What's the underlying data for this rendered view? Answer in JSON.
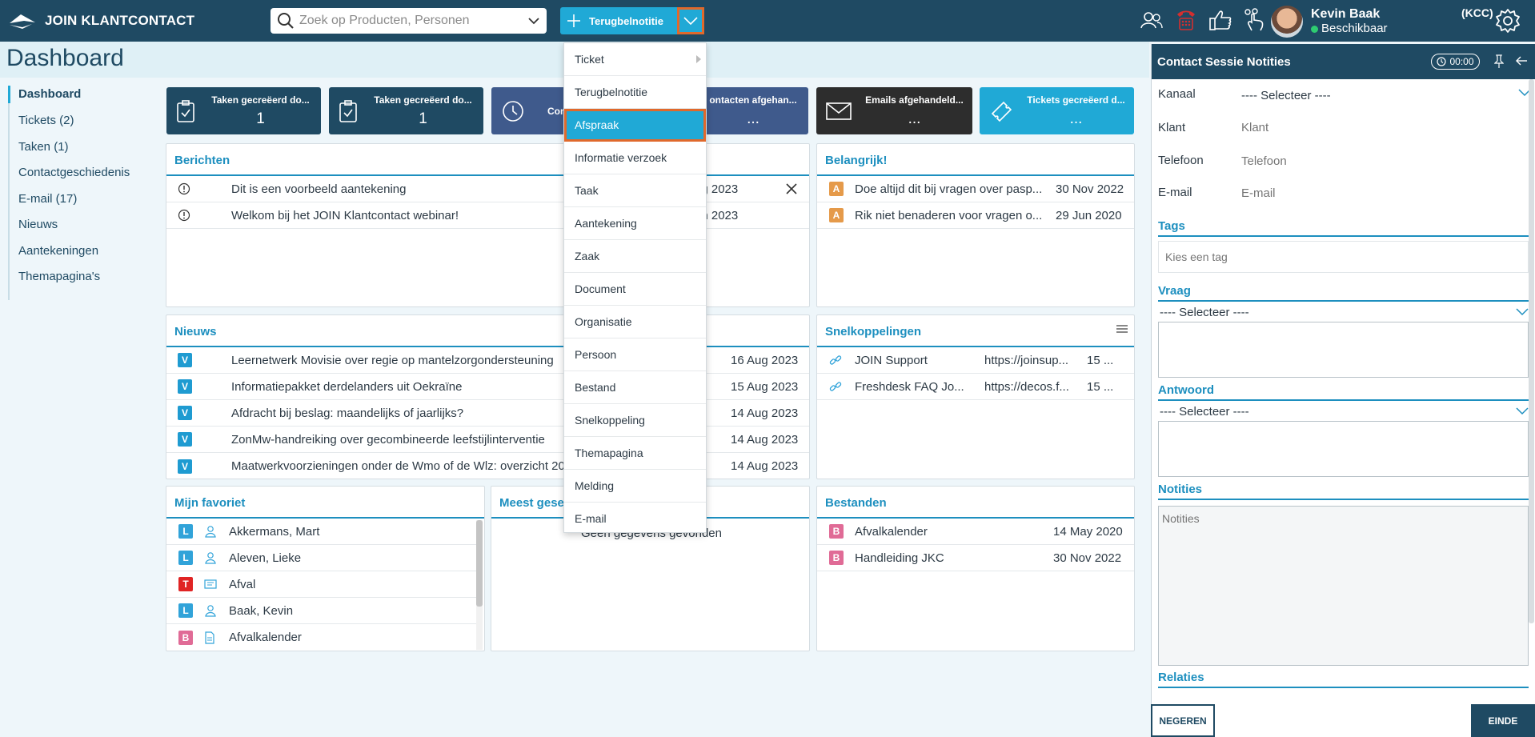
{
  "app": {
    "title": "JOIN KLANTCONTACT"
  },
  "search": {
    "placeholder": "Zoek op Producten, Personen"
  },
  "new_button": {
    "label": "Terugbelnotitie"
  },
  "user": {
    "name": "Kevin Baak",
    "status": "Beschikbaar",
    "role": "(KCC)"
  },
  "page": {
    "title": "Dashboard"
  },
  "sidebar": {
    "items": [
      {
        "label": "Dashboard"
      },
      {
        "label": "Tickets (2)"
      },
      {
        "label": "Taken (1)"
      },
      {
        "label": "Contactgeschiedenis"
      },
      {
        "label": "E-mail (17)"
      },
      {
        "label": "Nieuws"
      },
      {
        "label": "Aantekeningen"
      },
      {
        "label": "Themapagina's"
      }
    ]
  },
  "kpis": [
    {
      "label": "Taken gecreëerd do...",
      "value": "1",
      "color": "#1f4a63"
    },
    {
      "label": "Taken gecreëerd do...",
      "value": "1",
      "color": "#1f4a63"
    },
    {
      "label": "Conta",
      "value": "",
      "color": "#3f5a8c"
    },
    {
      "label": "ontacten afgehan...",
      "value": "...",
      "color": "#3f5a8c"
    },
    {
      "label": "Emails afgehandeld...",
      "value": "...",
      "color": "#2d2d2d"
    },
    {
      "label": "Tickets gecreëerd d...",
      "value": "...",
      "color": "#20a9d6"
    }
  ],
  "berichten": {
    "title": "Berichten",
    "rows": [
      {
        "text": "Dit is een voorbeeld aantekening",
        "date": "ug 2023"
      },
      {
        "text": "Welkom bij het JOIN Klantcontact webinar!",
        "date": "un 2023"
      }
    ]
  },
  "belangrijk": {
    "title": "Belangrijk!",
    "rows": [
      {
        "badge": "A",
        "text": "Doe altijd dit bij vragen over pasp...",
        "date": "30 Nov 2022"
      },
      {
        "badge": "A",
        "text": "Rik niet benaderen voor vragen o...",
        "date": "29 Jun 2020"
      }
    ]
  },
  "nieuws": {
    "title": "Nieuws",
    "rows": [
      {
        "badge": "V",
        "text": "Leernetwerk Movisie over regie op mantelzorgondersteuning",
        "date": "16 Aug 2023"
      },
      {
        "badge": "V",
        "text": "Informatiepakket derdelanders uit Oekraïne",
        "date": "15 Aug 2023"
      },
      {
        "badge": "V",
        "text": "Afdracht bij beslag: maandelijks of jaarlijks?",
        "date": "14 Aug 2023"
      },
      {
        "badge": "V",
        "text": "ZonMw-handreiking over gecombineerde leefstijlinterventie",
        "date": "14 Aug 2023"
      },
      {
        "badge": "V",
        "text": "Maatwerkvoorzieningen onder de Wmo of de Wlz: overzicht 20",
        "date": "14 Aug 2023"
      }
    ]
  },
  "snelkoppelingen": {
    "title": "Snelkoppelingen",
    "rows": [
      {
        "text": "JOIN Support",
        "url": "https://joinsup...",
        "extra": "15 ..."
      },
      {
        "text": "Freshdesk FAQ Jo...",
        "url": "https://decos.f...",
        "extra": "15 ..."
      }
    ]
  },
  "favoriet": {
    "title": "Mijn favoriet",
    "rows": [
      {
        "badge": "L",
        "type": "person",
        "text": "Akkermans, Mart"
      },
      {
        "badge": "L",
        "type": "person",
        "text": "Aleven, Lieke"
      },
      {
        "badge": "T",
        "type": "card",
        "text": "Afval"
      },
      {
        "badge": "L",
        "type": "person",
        "text": "Baak, Kevin"
      },
      {
        "badge": "B",
        "type": "doc",
        "text": "Afvalkalender"
      }
    ]
  },
  "meest": {
    "title": "Meest gese",
    "empty": "Geen gegevens gevonden"
  },
  "bestanden": {
    "title": "Bestanden",
    "rows": [
      {
        "badge": "B",
        "text": "Afvalkalender",
        "date": "14 May 2020"
      },
      {
        "badge": "B",
        "text": "Handleiding JKC",
        "date": "30 Nov 2022"
      }
    ]
  },
  "dropdown": {
    "items": [
      {
        "label": "Ticket"
      },
      {
        "label": "Terugbelnotitie"
      },
      {
        "label": "Afspraak"
      },
      {
        "label": "Informatie verzoek"
      },
      {
        "label": "Taak"
      },
      {
        "label": "Aantekening"
      },
      {
        "label": "Zaak"
      },
      {
        "label": "Document"
      },
      {
        "label": "Organisatie"
      },
      {
        "label": "Persoon"
      },
      {
        "label": "Bestand"
      },
      {
        "label": "Snelkoppeling"
      },
      {
        "label": "Themapagina"
      },
      {
        "label": "Melding"
      },
      {
        "label": "E-mail"
      }
    ]
  },
  "session": {
    "title": "Contact Sessie Notities",
    "timer": "00:00",
    "kanaal_label": "Kanaal",
    "kanaal_value": "---- Selecteer ----",
    "klant_label": "Klant",
    "klant_placeholder": "Klant",
    "telefoon_label": "Telefoon",
    "telefoon_placeholder": "Telefoon",
    "email_label": "E-mail",
    "email_placeholder": "E-mail",
    "tags_title": "Tags",
    "tags_placeholder": "Kies een tag",
    "vraag_title": "Vraag",
    "vraag_select": "---- Selecteer ----",
    "antwoord_title": "Antwoord",
    "antwoord_select": "---- Selecteer ----",
    "notities_title": "Notities",
    "notities_placeholder": "Notities",
    "relaties_title": "Relaties",
    "negeren": "NEGEREN",
    "einde": "EINDE"
  }
}
